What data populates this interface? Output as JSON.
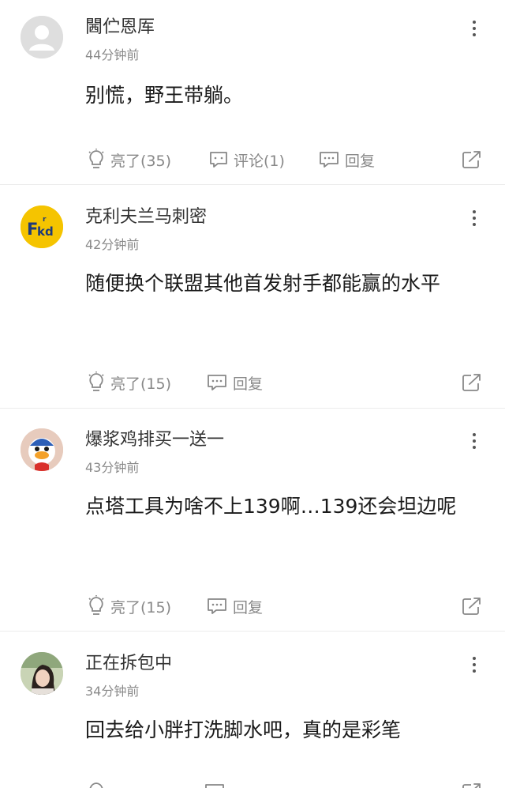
{
  "comments": [
    {
      "username": "閪伫恩厍",
      "time": "44分钟前",
      "body": "别慌，野王带躺。",
      "like_label": "亮了(35)",
      "comment_label": "评论(1)",
      "reply_label": "回复",
      "avatar_icon": "default-user-icon"
    },
    {
      "username": "克利夫兰马刺密",
      "time": "42分钟前",
      "body": "随便换个联盟其他首发射手都能赢的水平",
      "like_label": "亮了(15)",
      "reply_label": "回复",
      "avatar_text": "Fkd",
      "avatar_color": "#f5c400"
    },
    {
      "username": "爆浆鸡排买一送一",
      "time": "43分钟前",
      "body": "点塔工具为啥不上139啊…139还会坦边呢",
      "like_label": "亮了(15)",
      "reply_label": "回复",
      "avatar_icon": "cartoon-avatar-icon"
    },
    {
      "username": "正在拆包中",
      "time": "34分钟前",
      "body": "回去给小胖打洗脚水吧，真的是彩笔",
      "avatar_icon": "photo-avatar-icon"
    }
  ],
  "colors": {
    "muted": "#888888",
    "divider": "#ececec",
    "avatar_default": "#dcdcdc"
  }
}
